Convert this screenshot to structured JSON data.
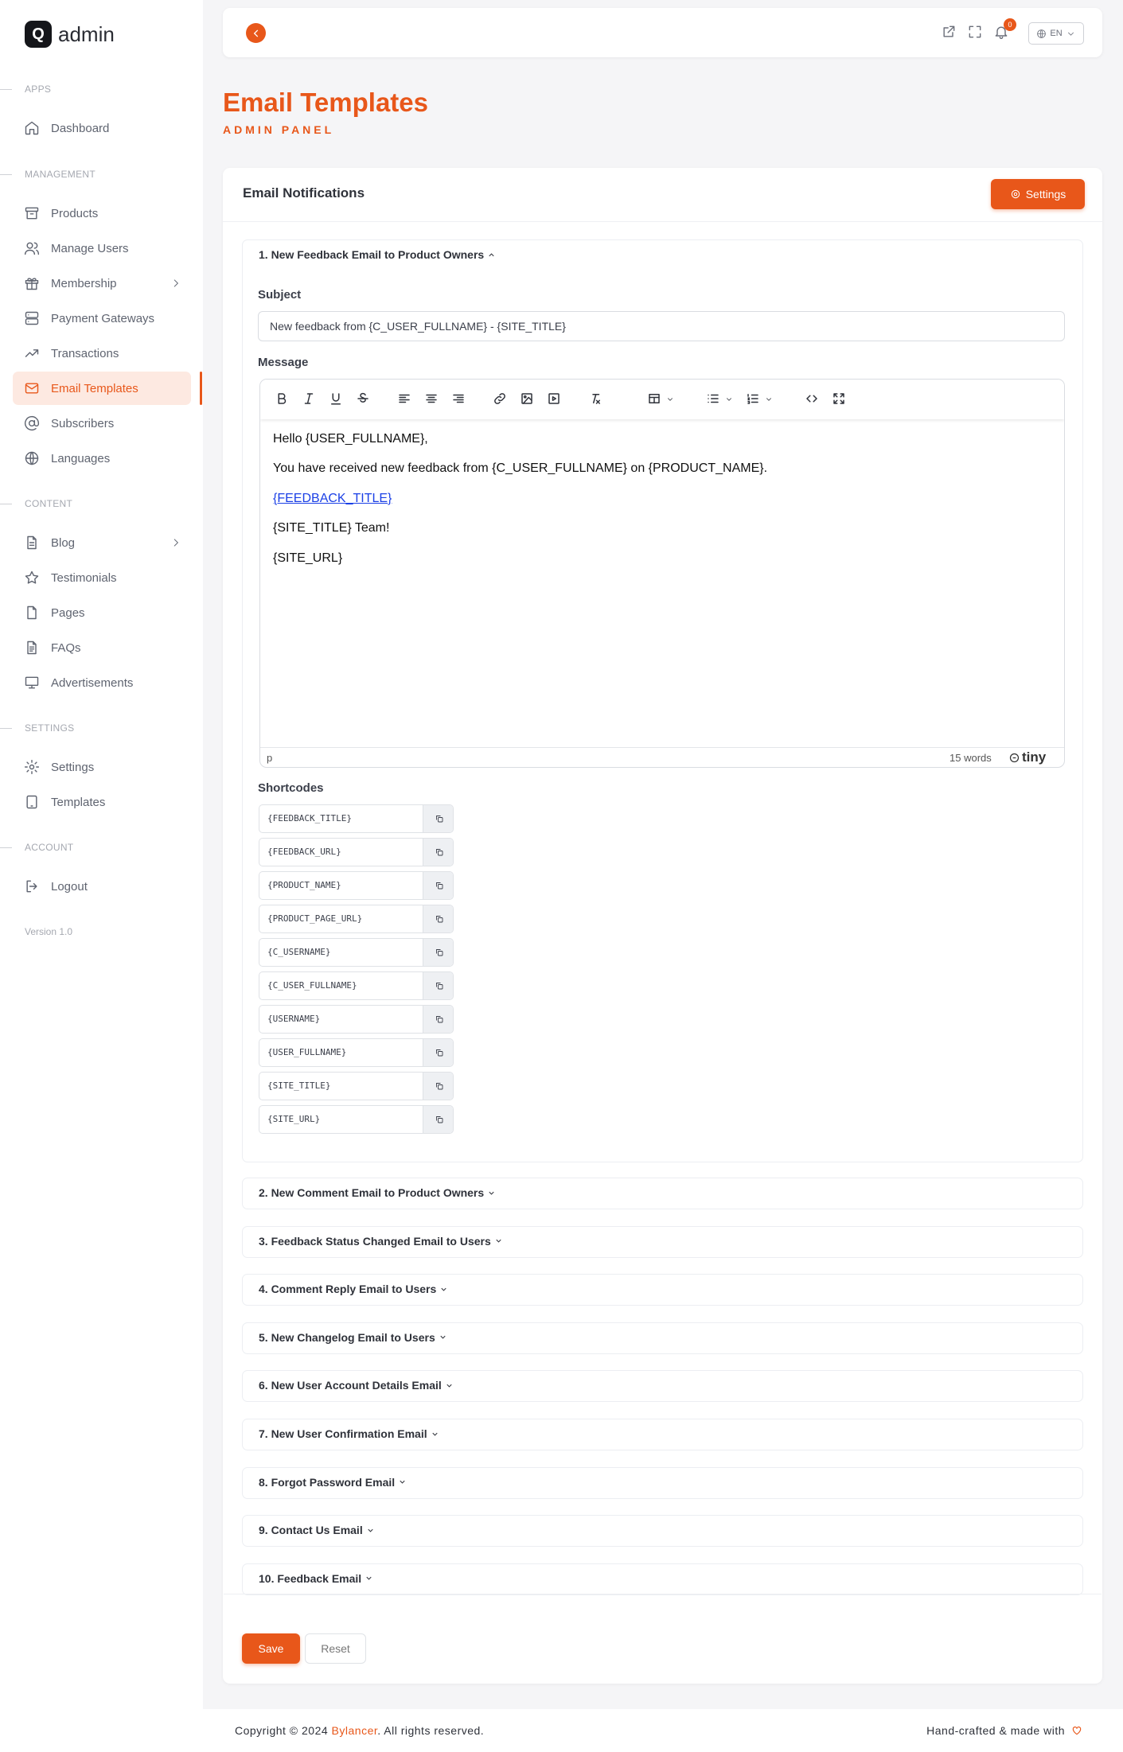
{
  "app": {
    "logo_letter": "Q",
    "name": "admin",
    "version": "Version 1.0"
  },
  "sidebar": {
    "sections": {
      "apps": "APPS",
      "management": "MANAGEMENT",
      "content": "CONTENT",
      "settings": "SETTINGS",
      "account": "ACCOUNT"
    },
    "items": {
      "dashboard": "Dashboard",
      "products": "Products",
      "manage_users": "Manage Users",
      "membership": "Membership",
      "payment_gateways": "Payment Gateways",
      "transactions": "Transactions",
      "email_templates": "Email Templates",
      "subscribers": "Subscribers",
      "languages": "Languages",
      "blog": "Blog",
      "testimonials": "Testimonials",
      "pages": "Pages",
      "faqs": "FAQs",
      "advertisements": "Advertisements",
      "settings": "Settings",
      "templates": "Templates",
      "logout": "Logout"
    },
    "active": "Email Templates"
  },
  "topbar": {
    "notification_count": "0",
    "language": "EN"
  },
  "page": {
    "title": "Email Templates",
    "subtitle": "ADMIN PANEL"
  },
  "card": {
    "title": "Email Notifications",
    "settings_label": "Settings"
  },
  "accordion": [
    {
      "label": "1. New Feedback Email to Product Owners",
      "expanded": true
    },
    {
      "label": "2. New Comment Email to Product Owners"
    },
    {
      "label": "3. Feedback Status Changed Email to Users"
    },
    {
      "label": "4. Comment Reply Email to Users"
    },
    {
      "label": "5. New Changelog Email to Users"
    },
    {
      "label": "6. New User Account Details Email"
    },
    {
      "label": "7. New User Confirmation Email"
    },
    {
      "label": "8. Forgot Password Email"
    },
    {
      "label": "9. Contact Us Email"
    },
    {
      "label": "10. Feedback Email"
    }
  ],
  "form": {
    "subject_label": "Subject",
    "subject_value": "New feedback from {C_USER_FULLNAME} - {SITE_TITLE}",
    "message_label": "Message",
    "editor_lines": [
      "Hello {USER_FULLNAME},",
      "You have received new feedback from {C_USER_FULLNAME} on {PRODUCT_NAME}.",
      "{FEEDBACK_TITLE}",
      "{SITE_TITLE} Team!",
      "{SITE_URL}"
    ],
    "status_path": "p",
    "word_count": "15 words",
    "editor_brand": "tiny",
    "shortcodes_label": "Shortcodes",
    "shortcodes": [
      "{FEEDBACK_TITLE}",
      "{FEEDBACK_URL}",
      "{PRODUCT_NAME}",
      "{PRODUCT_PAGE_URL}",
      "{C_USERNAME}",
      "{C_USER_FULLNAME}",
      "{USERNAME}",
      "{USER_FULLNAME}",
      "{SITE_TITLE}",
      "{SITE_URL}"
    ],
    "save_label": "Save",
    "reset_label": "Reset"
  },
  "footer": {
    "copyright_prefix": "Copyright © 2024 ",
    "brand": "Bylancer",
    "copyright_suffix": ". All rights reserved.",
    "made_with": "Hand-crafted & made with"
  },
  "colors": {
    "accent": "#e8571a",
    "active_bg": "#fde9e1",
    "link": "#1a3fe6"
  }
}
